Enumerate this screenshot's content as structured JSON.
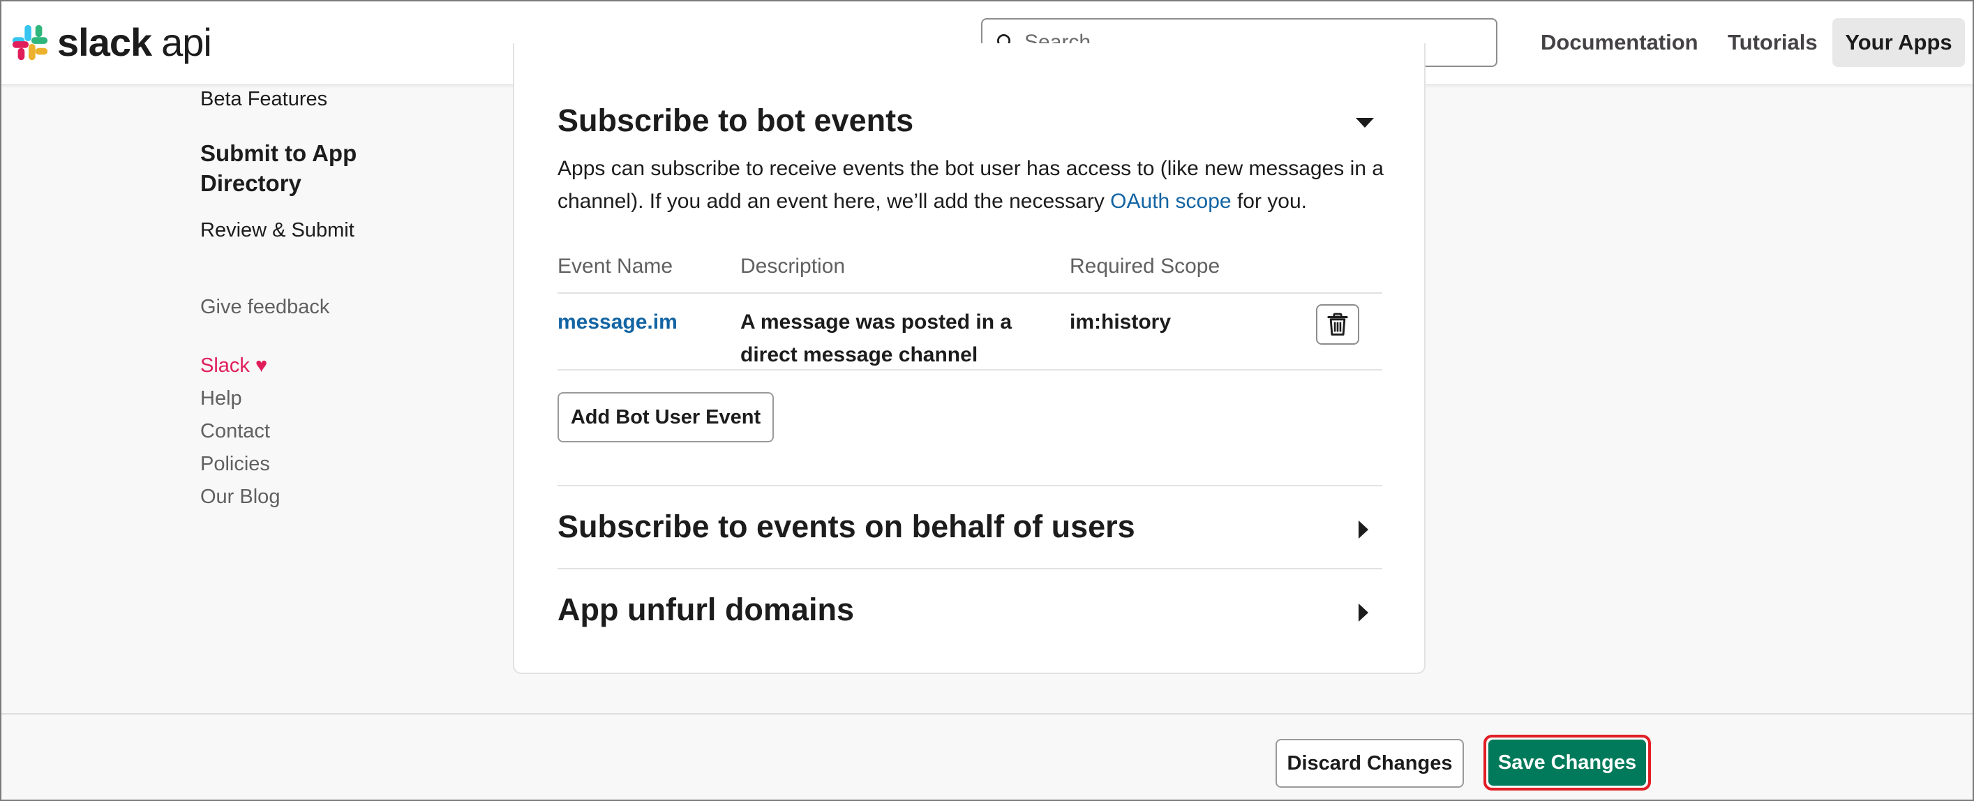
{
  "header": {
    "logo_word": "slack",
    "logo_suffix": "api",
    "search_placeholder": "Search",
    "nav": {
      "documentation": "Documentation",
      "tutorials": "Tutorials",
      "your_apps": "Your Apps"
    }
  },
  "sidebar": {
    "beta_features": "Beta Features",
    "submit_heading": "Submit to App Directory",
    "review_submit": "Review & Submit",
    "give_feedback": "Give feedback",
    "slack_love": "Slack ♥",
    "help": "Help",
    "contact": "Contact",
    "policies": "Policies",
    "our_blog": "Our Blog"
  },
  "bot_events": {
    "title": "Subscribe to bot events",
    "description_before": "Apps can subscribe to receive events the bot user has access to (like new messages in a channel). If you add an event here, we’ll add the necessary ",
    "description_link": "OAuth scope",
    "description_after": " for you.",
    "columns": {
      "event_name": "Event Name",
      "description": "Description",
      "required_scope": "Required Scope"
    },
    "rows": [
      {
        "event_name": "message.im",
        "description": "A message was posted in a direct message channel",
        "required_scope": "im:history"
      }
    ],
    "add_button": "Add Bot User Event"
  },
  "user_events": {
    "title": "Subscribe to events on behalf of users"
  },
  "unfurl": {
    "title": "App unfurl domains"
  },
  "footer": {
    "discard": "Discard Changes",
    "save": "Save Changes"
  },
  "colors": {
    "link": "#1264a3",
    "save": "#007a5a",
    "highlight": "#e01e24",
    "slack_love": "#e01e5a"
  }
}
